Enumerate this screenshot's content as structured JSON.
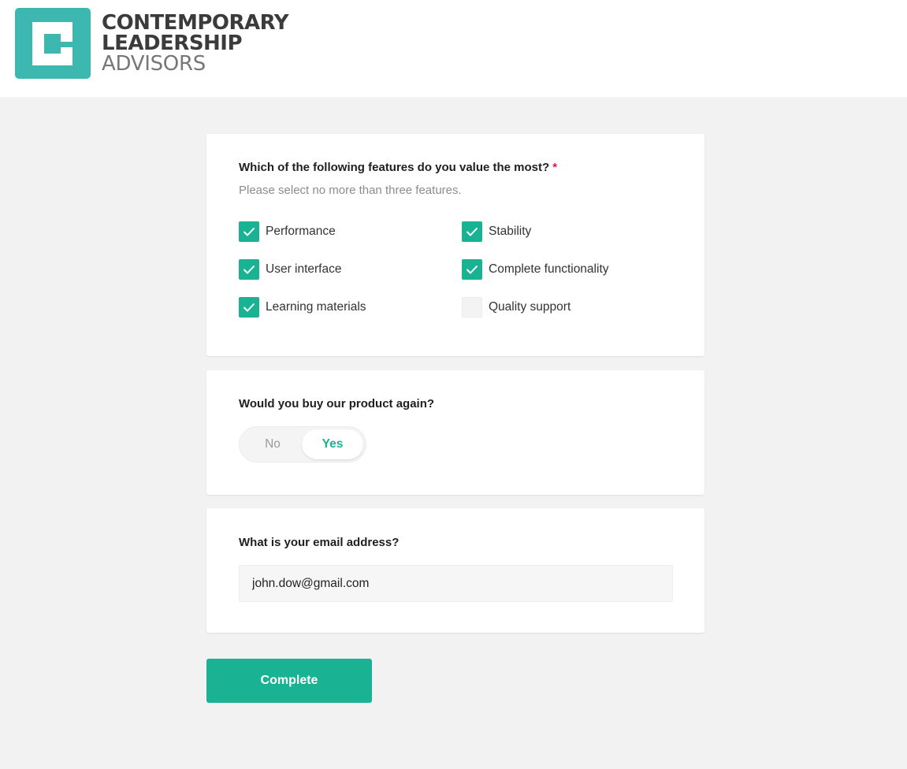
{
  "brand": {
    "line1": "CONTEMPORARY",
    "line2": "LEADERSHIP",
    "line3": "ADVISORS",
    "logo_icon": "cla-logo-mark",
    "accent": "#3cb8b1"
  },
  "features": {
    "question": "Which of the following features do you value the most?",
    "required_mark": "*",
    "hint": "Please select no more than three features.",
    "options": [
      {
        "label": "Performance",
        "checked": true
      },
      {
        "label": "Stability",
        "checked": true
      },
      {
        "label": "User interface",
        "checked": true
      },
      {
        "label": "Complete functionality",
        "checked": true
      },
      {
        "label": "Learning materials",
        "checked": true
      },
      {
        "label": "Quality support",
        "checked": false
      }
    ]
  },
  "rebuy": {
    "question": "Would you buy our product again?",
    "options": [
      "No",
      "Yes"
    ],
    "selected": "Yes"
  },
  "email": {
    "question": "What is your email address?",
    "value": "john.dow@gmail.com"
  },
  "actions": {
    "complete_label": "Complete"
  },
  "colors": {
    "primary": "#19b394",
    "required": "#e0194c",
    "page_bg": "#f2f2f2"
  }
}
